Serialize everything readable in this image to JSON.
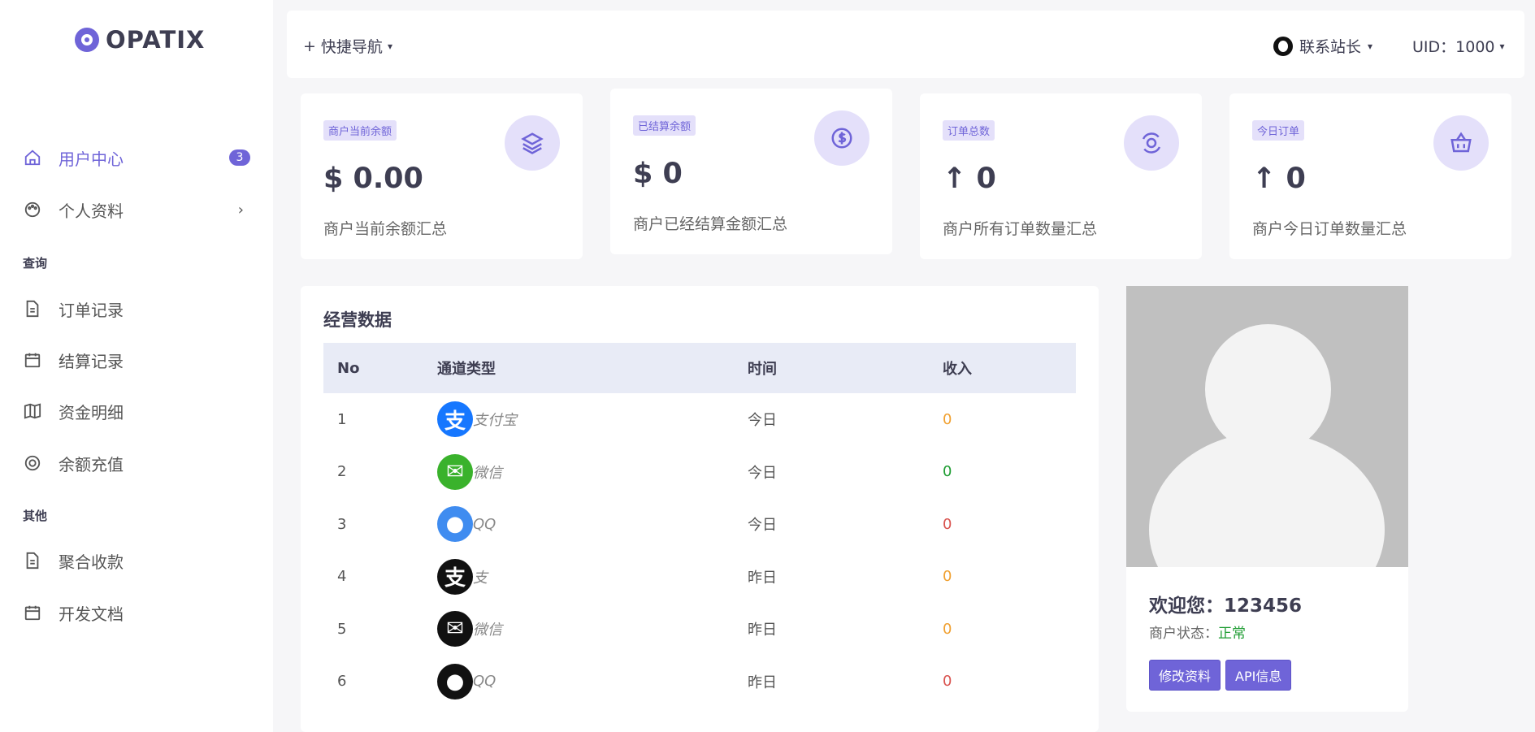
{
  "brand": {
    "name": "OPATIX",
    "accent": "#6f64d8"
  },
  "sidebar": {
    "items": [
      {
        "label": "用户中心",
        "badge": "3"
      },
      {
        "label": "个人资料"
      }
    ],
    "section_query": "查询",
    "query_items": [
      {
        "label": "订单记录"
      },
      {
        "label": "结算记录"
      },
      {
        "label": "资金明细"
      },
      {
        "label": "余额充值"
      }
    ],
    "section_other": "其他",
    "other_items": [
      {
        "label": "聚合收款"
      },
      {
        "label": "开发文档"
      }
    ]
  },
  "topbar": {
    "quick_nav": "快捷导航",
    "contact": "联系站长",
    "uid": "UID：1000"
  },
  "stats": [
    {
      "tag": "商户当前余额",
      "value": "$ 0.00",
      "desc": "商户当前余额汇总",
      "icon": "layers-icon"
    },
    {
      "tag": "已结算余额",
      "value": "$ 0",
      "desc": "商户已经结算金额汇总",
      "icon": "dollar-coin-icon"
    },
    {
      "tag": "订单总数",
      "value": "0",
      "desc": "商户所有订单数量汇总",
      "icon": "target-icon"
    },
    {
      "tag": "今日订单",
      "value": "0",
      "desc": "商户今日订单数量汇总",
      "icon": "basket-icon"
    }
  ],
  "ops": {
    "title": "经营数据",
    "headers": {
      "no": "No",
      "channel": "通道类型",
      "time": "时间",
      "income": "收入"
    },
    "rows": [
      {
        "no": "1",
        "channel": "支付宝",
        "time": "今日",
        "income": "0"
      },
      {
        "no": "2",
        "channel": "微信",
        "time": "今日",
        "income": "0"
      },
      {
        "no": "3",
        "channel": "QQ",
        "time": "今日",
        "income": "0"
      },
      {
        "no": "4",
        "channel": "支",
        "time": "昨日",
        "income": "0"
      },
      {
        "no": "5",
        "channel": "微信",
        "time": "昨日",
        "income": "0"
      },
      {
        "no": "6",
        "channel": "QQ",
        "time": "昨日",
        "income": "0"
      }
    ]
  },
  "profile": {
    "welcome_label": "欢迎您：",
    "username": "123456",
    "status_label": "商户状态：",
    "status_value": "正常",
    "edit_button": "修改资料",
    "api_button": "API信息"
  }
}
